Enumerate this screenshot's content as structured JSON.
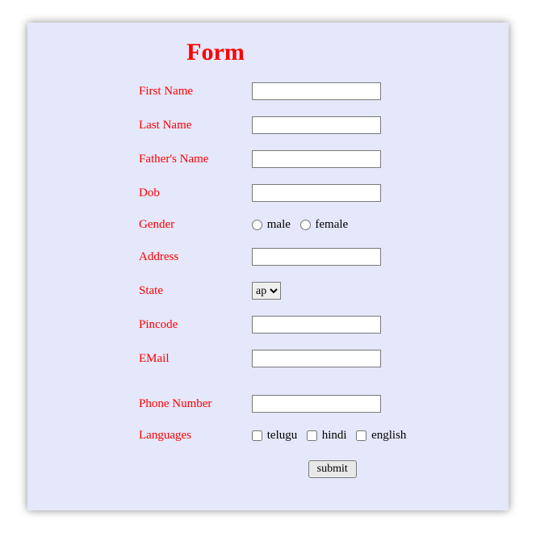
{
  "title": "Form",
  "fields": {
    "first_name": {
      "label": "First Name",
      "value": ""
    },
    "last_name": {
      "label": "Last Name",
      "value": ""
    },
    "father_name": {
      "label": "Father's Name",
      "value": ""
    },
    "dob": {
      "label": "Dob",
      "value": ""
    },
    "gender": {
      "label": "Gender",
      "options": [
        "male",
        "female"
      ],
      "value": ""
    },
    "address": {
      "label": "Address",
      "value": ""
    },
    "state": {
      "label": "State",
      "selected": "ap",
      "options": [
        "ap"
      ]
    },
    "pincode": {
      "label": "Pincode",
      "value": ""
    },
    "email": {
      "label": "EMail",
      "value": ""
    },
    "phone": {
      "label": "Phone Number",
      "value": ""
    },
    "languages": {
      "label": "Languages",
      "options": [
        "telugu",
        "hindi",
        "english"
      ],
      "value": []
    }
  },
  "submit_label": "submit"
}
